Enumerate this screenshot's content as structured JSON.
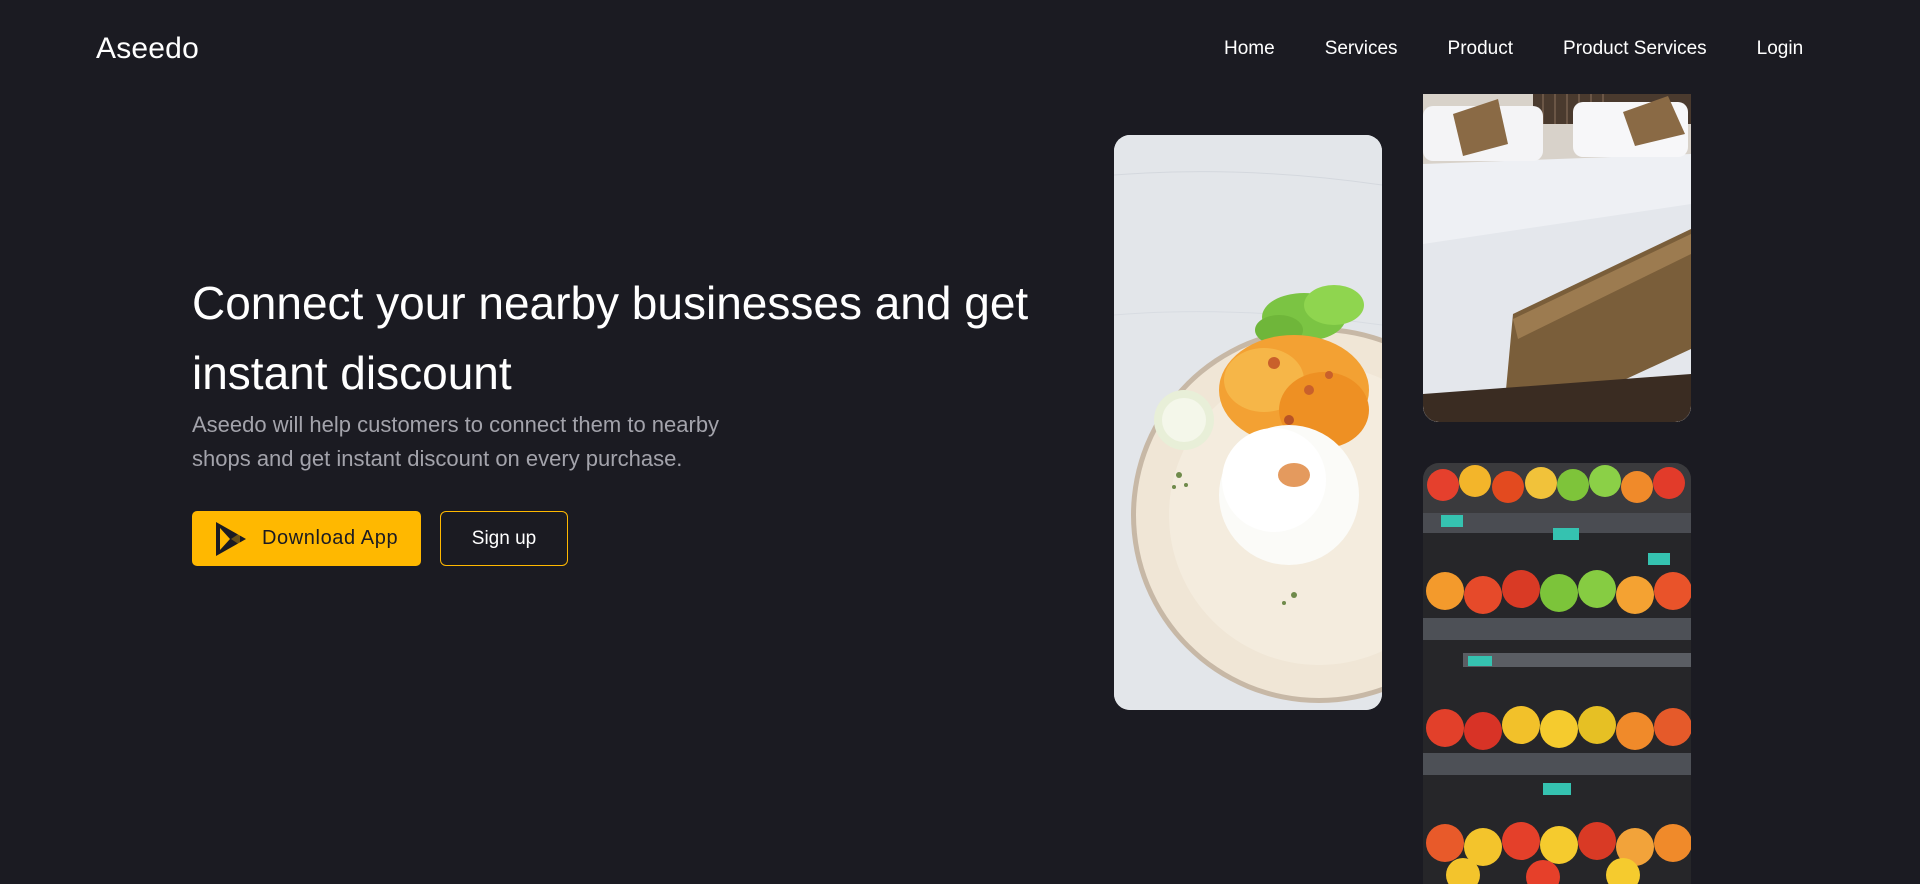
{
  "brand": {
    "name": "Aseedo"
  },
  "nav": {
    "items": [
      "Home",
      "Services",
      "Product",
      "Product Services",
      "Login"
    ]
  },
  "hero": {
    "title": "Connect your nearby businesses and get instant discount",
    "subtitle": "Aseedo will help customers to connect them to nearby shops and get instant discount on every purchase.",
    "download_label": "Download App",
    "signup_label": "Sign up"
  },
  "images": {
    "food": "plate-of-rice-and-curry",
    "bed": "hotel-bed",
    "fruit": "supermarket-fruit-shelves"
  },
  "colors": {
    "background": "#1b1b22",
    "accent": "#ffb800",
    "text": "#ffffff",
    "muted": "#a3a3ab"
  }
}
